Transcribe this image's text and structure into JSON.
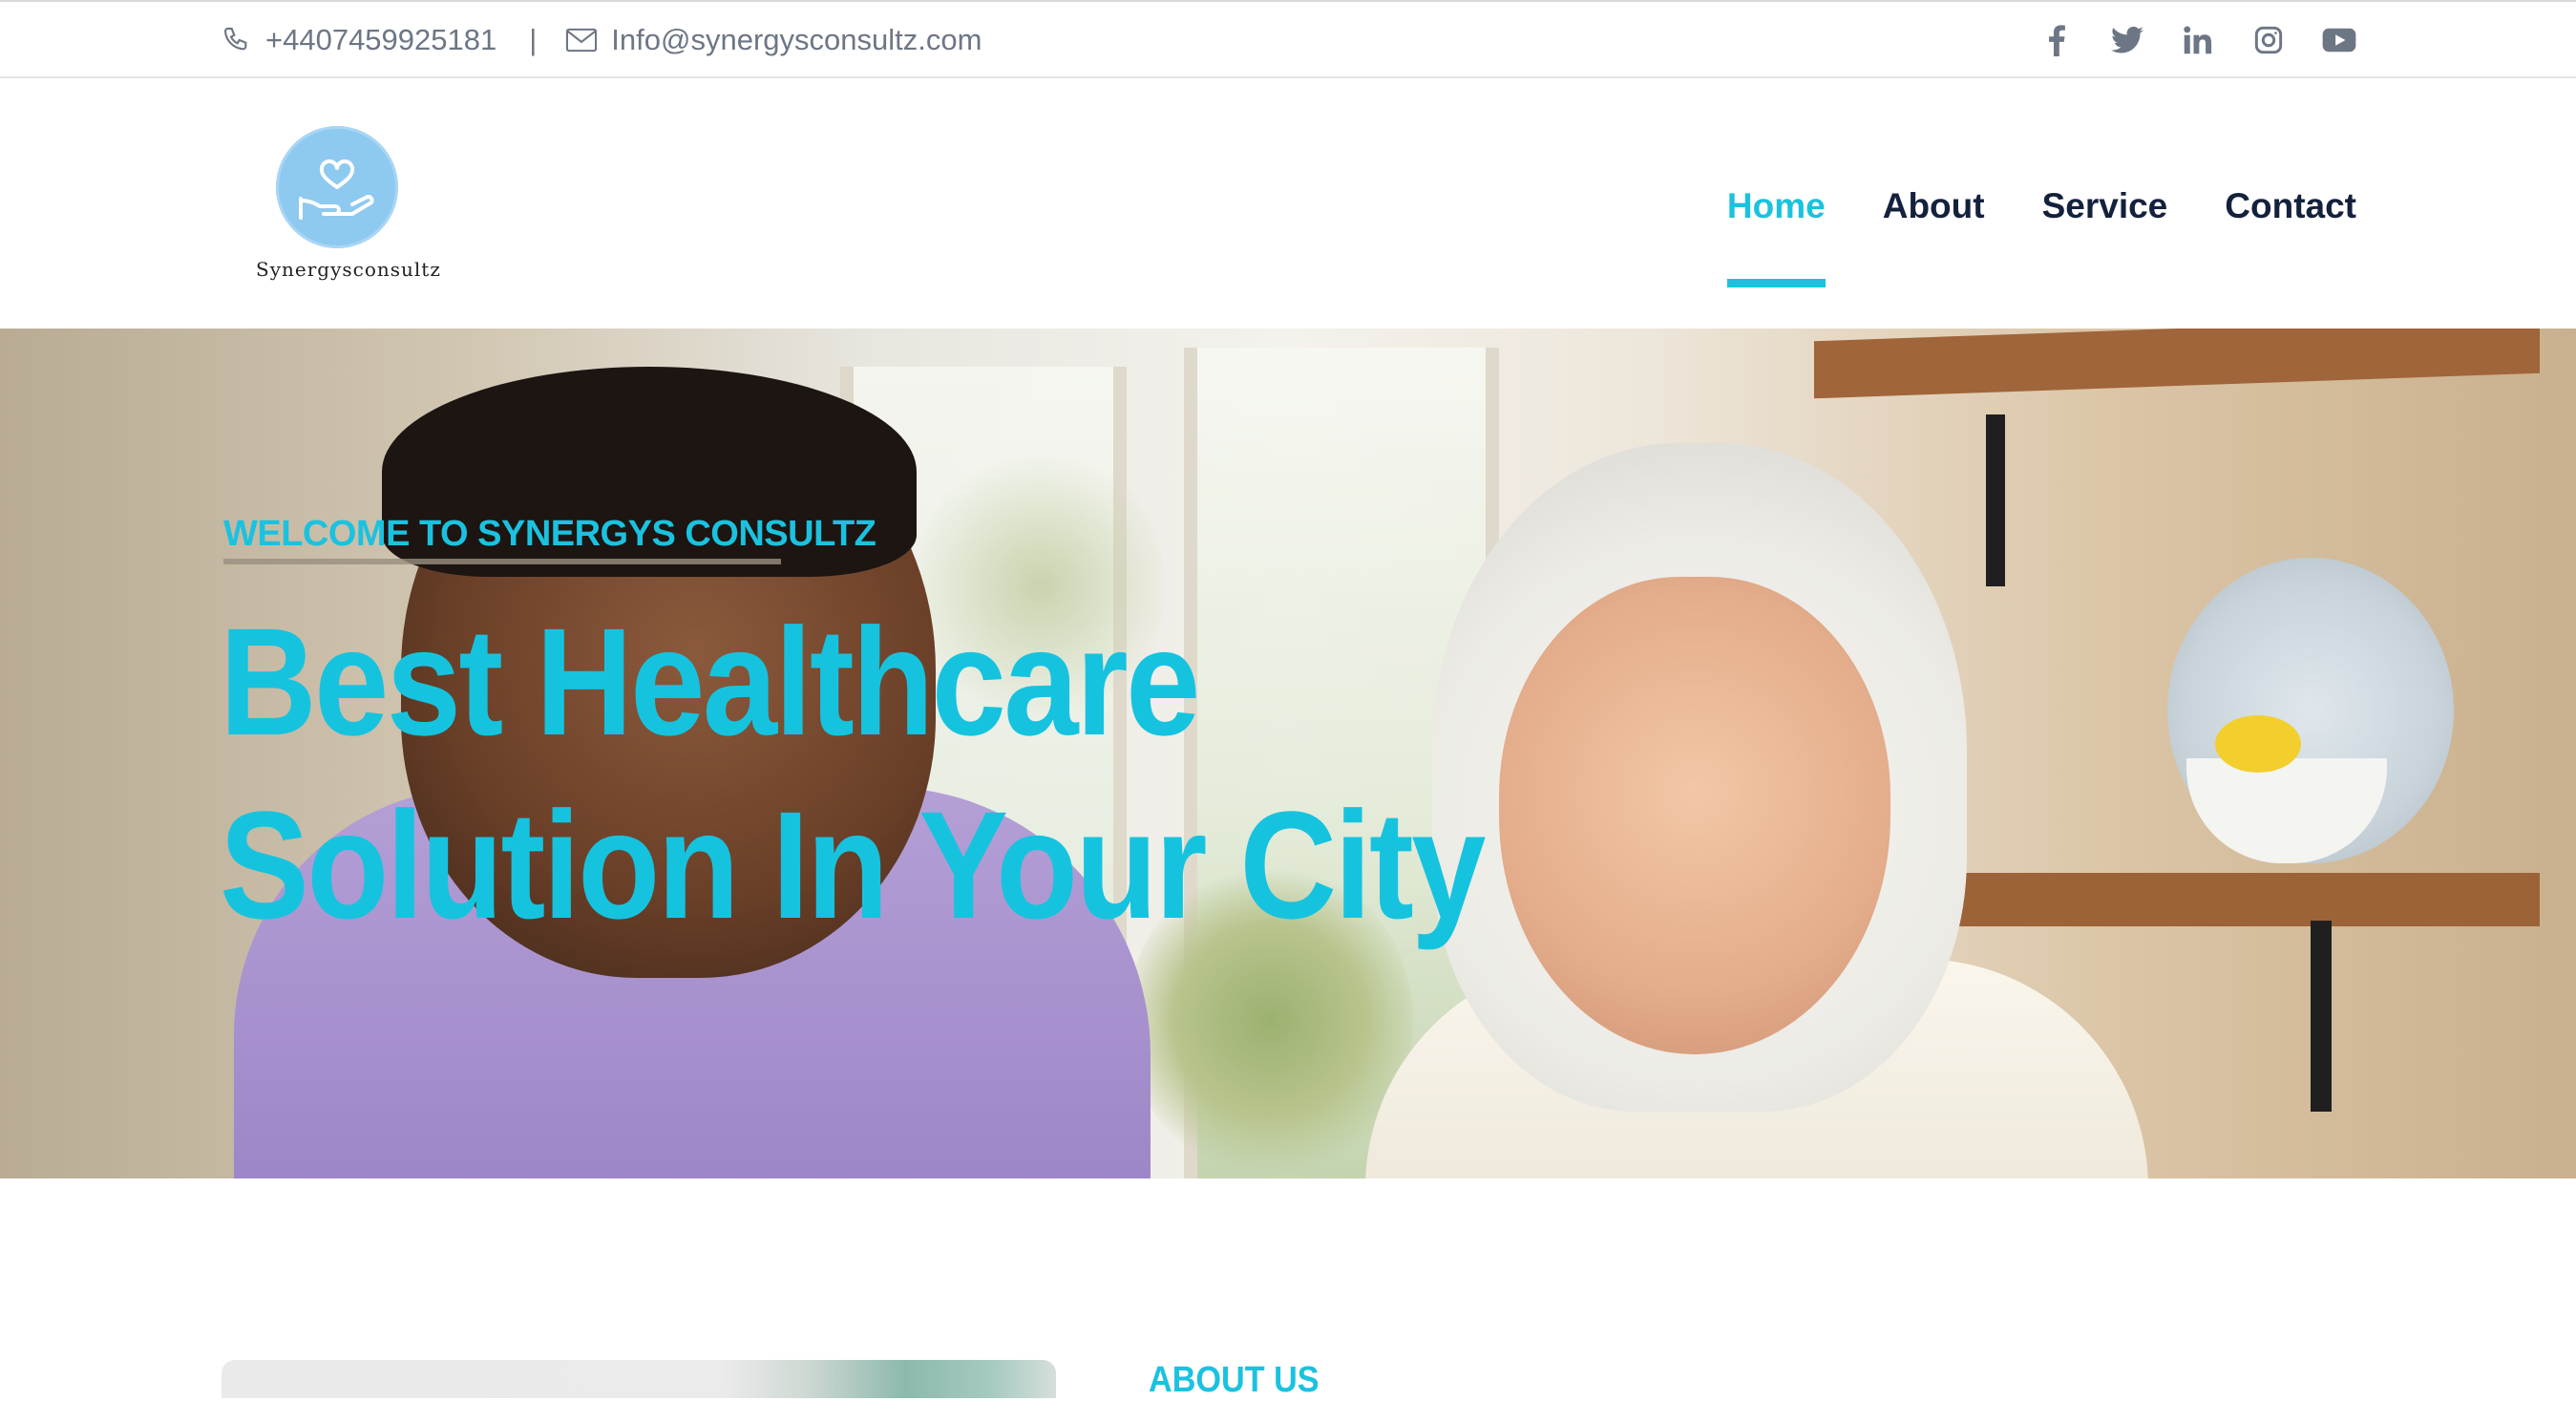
{
  "topbar": {
    "phone": "+4407459925181",
    "separator": "|",
    "email": "Info@synergysconsultz.com",
    "socials": [
      "facebook-icon",
      "twitter-icon",
      "linkedin-icon",
      "instagram-icon",
      "youtube-icon"
    ]
  },
  "brand": {
    "name": "Synergysconsultz",
    "logo_icon": "heart-in-hand-icon",
    "logo_color": "#8ec9f0"
  },
  "nav": {
    "items": [
      {
        "label": "Home",
        "active": true
      },
      {
        "label": "About",
        "active": false
      },
      {
        "label": "Service",
        "active": false
      },
      {
        "label": "Contact",
        "active": false
      }
    ]
  },
  "hero": {
    "kicker": "WELCOME TO SYNERGYS CONSULTZ",
    "title_line1": "Best Healthcare",
    "title_line2": "Solution In Your City"
  },
  "about": {
    "label": "ABOUT US"
  },
  "colors": {
    "accent": "#1bc2df",
    "nav_text": "#14213d",
    "muted_text": "#6d7685"
  }
}
